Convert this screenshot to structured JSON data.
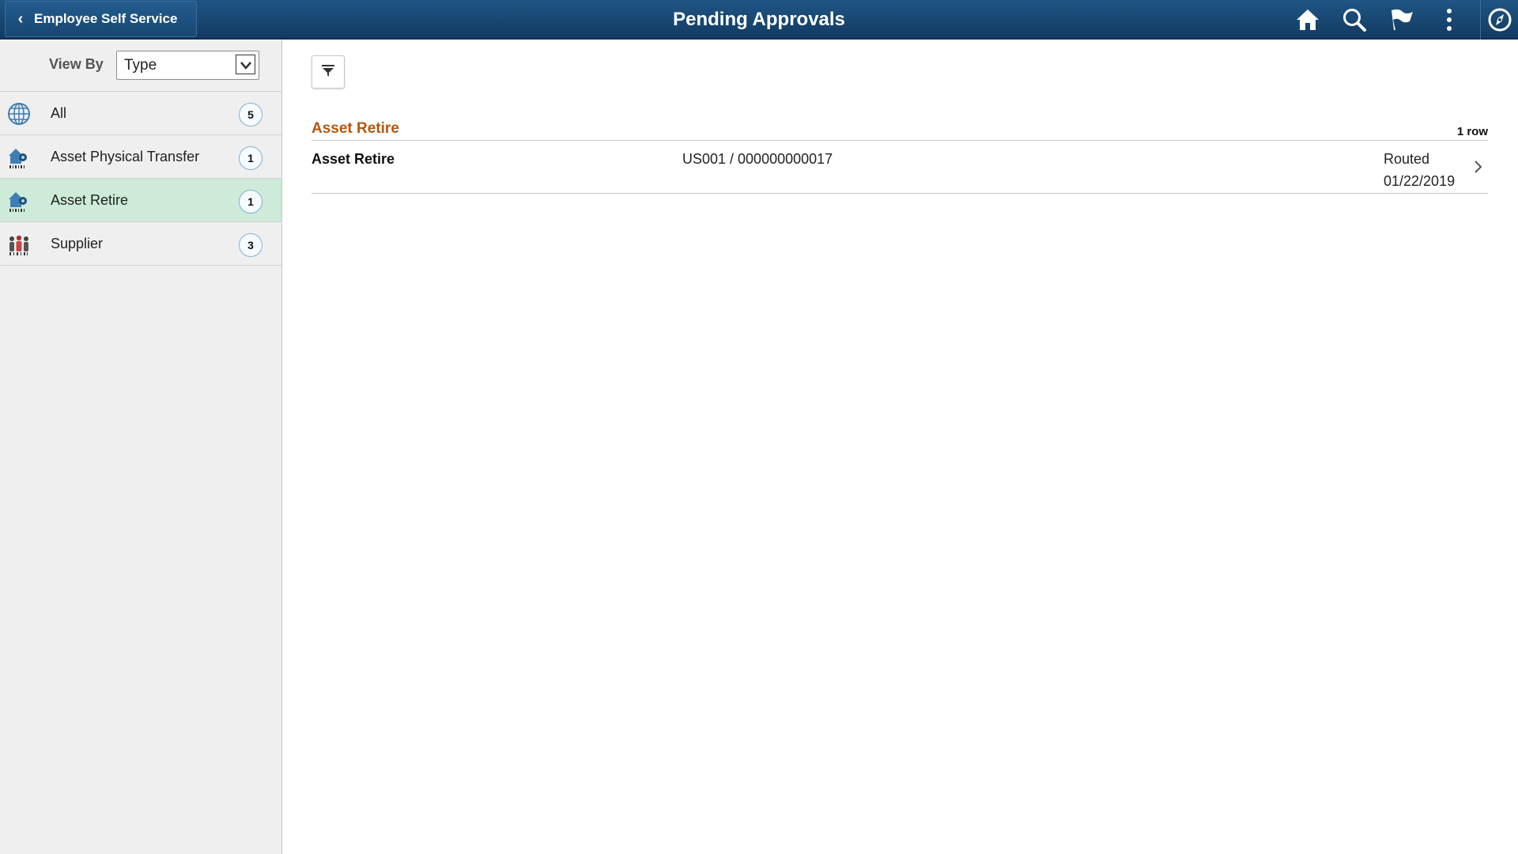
{
  "header": {
    "back_label": "Employee Self Service",
    "title": "Pending Approvals",
    "icons": [
      "home-icon",
      "search-icon",
      "flag-icon",
      "more-options-icon",
      "navbar-compass-icon"
    ]
  },
  "sidebar": {
    "view_by_label": "View By",
    "view_by_value": "Type",
    "items": [
      {
        "label": "All",
        "count": "5",
        "icon": "globe-icon"
      },
      {
        "label": "Asset Physical Transfer",
        "count": "1",
        "icon": "asset-icon"
      },
      {
        "label": "Asset Retire",
        "count": "1",
        "icon": "asset-icon",
        "selected": true
      },
      {
        "label": "Supplier",
        "count": "3",
        "icon": "people-icon"
      }
    ]
  },
  "main": {
    "group_title": "Asset Retire",
    "row_count": "1 row",
    "rows": [
      {
        "title": "Asset Retire",
        "reference": "US001 / 000000000017",
        "status": "Routed",
        "date": "01/22/2019"
      }
    ]
  },
  "colors": {
    "header_bg": "#1a4a77",
    "selected_bg": "#cdebd8",
    "group_title": "#b3570e"
  }
}
